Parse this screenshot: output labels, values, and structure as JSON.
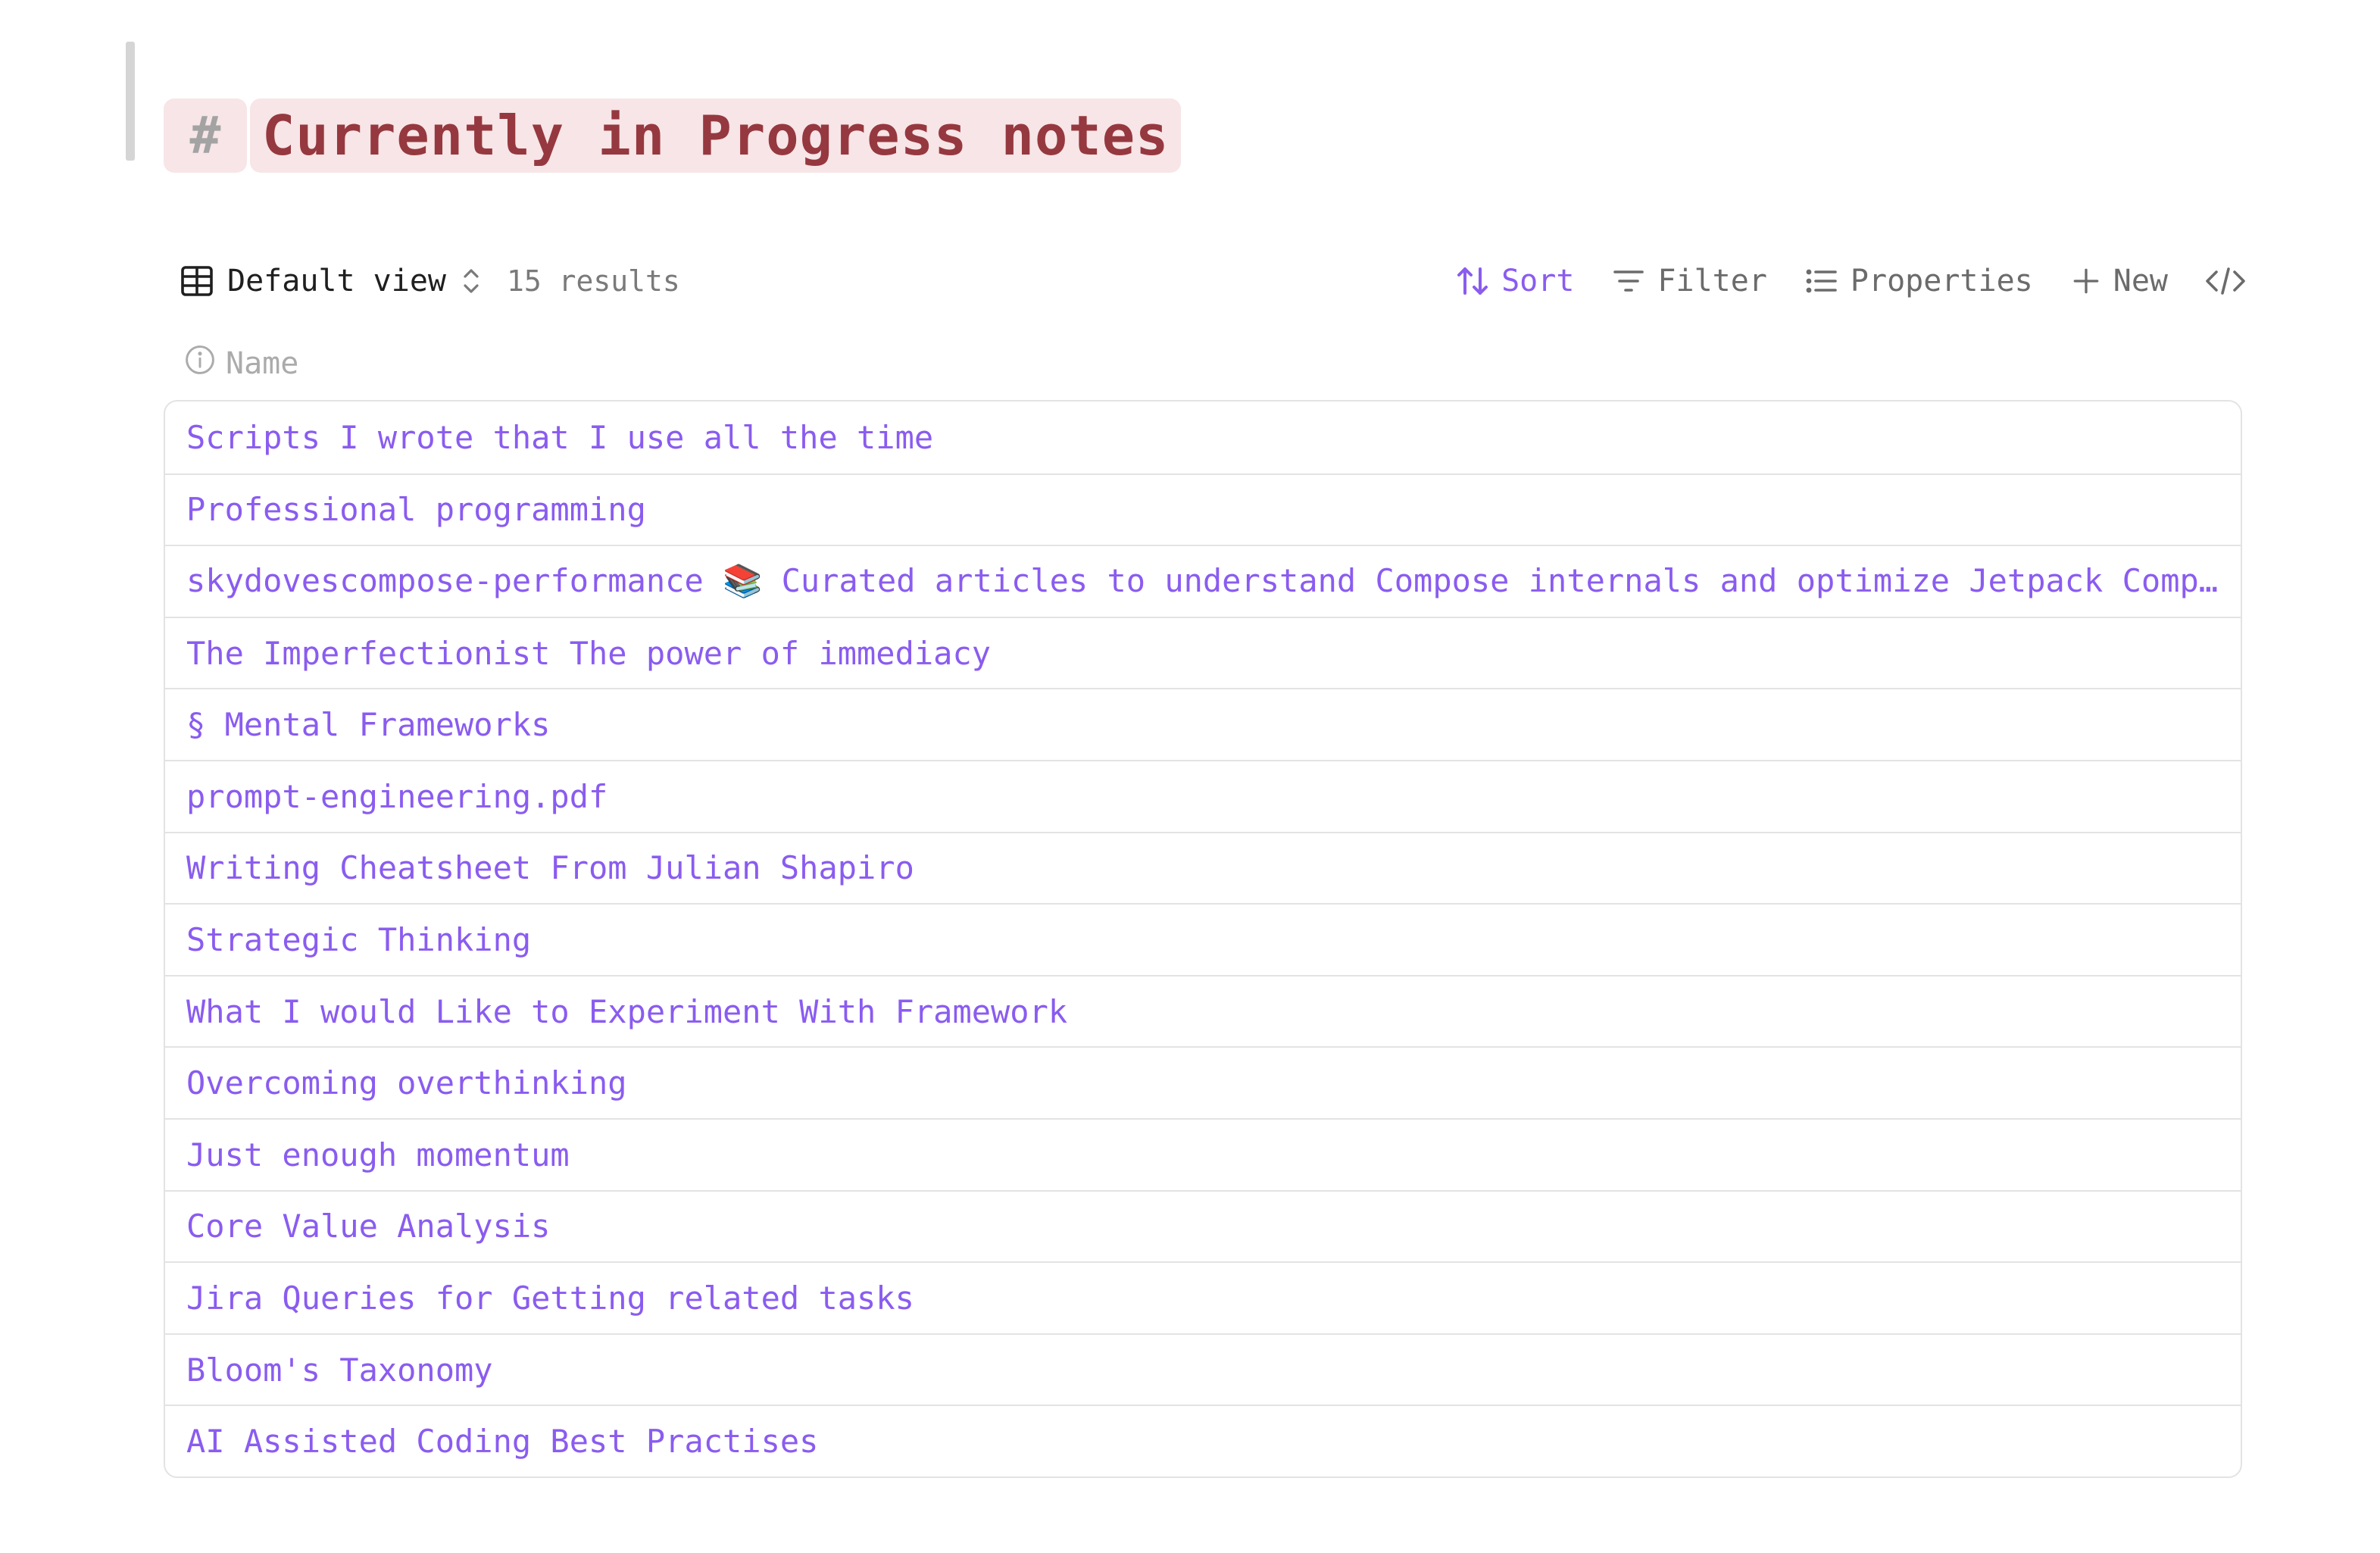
{
  "heading": {
    "hash": "#",
    "title": "Currently in Progress notes"
  },
  "toolbar": {
    "view_label": "Default view",
    "results": "15 results",
    "sort_label": "Sort",
    "filter_label": "Filter",
    "properties_label": "Properties",
    "new_label": "New"
  },
  "table": {
    "column_header": "Name",
    "rows": [
      "Scripts I wrote that I use all the time",
      "Professional programming",
      "skydovescompose-performance 📚 Curated articles to understand Compose internals and optimize Jetpack Compose performance",
      "The Imperfectionist The power of immediacy",
      "§ Mental Frameworks",
      "prompt-engineering.pdf",
      "Writing Cheatsheet From Julian Shapiro",
      "Strategic Thinking",
      "What I would Like to Experiment With Framework",
      "Overcoming overthinking",
      "Just enough momentum",
      "Core Value Analysis",
      "Jira Queries for Getting related tasks",
      "Bloom's Taxonomy",
      "AI Assisted Coding Best Practises"
    ]
  },
  "colors": {
    "accent": "#8a5cf0",
    "heading_text": "#96383f",
    "heading_bg": "#f7e5e7"
  }
}
